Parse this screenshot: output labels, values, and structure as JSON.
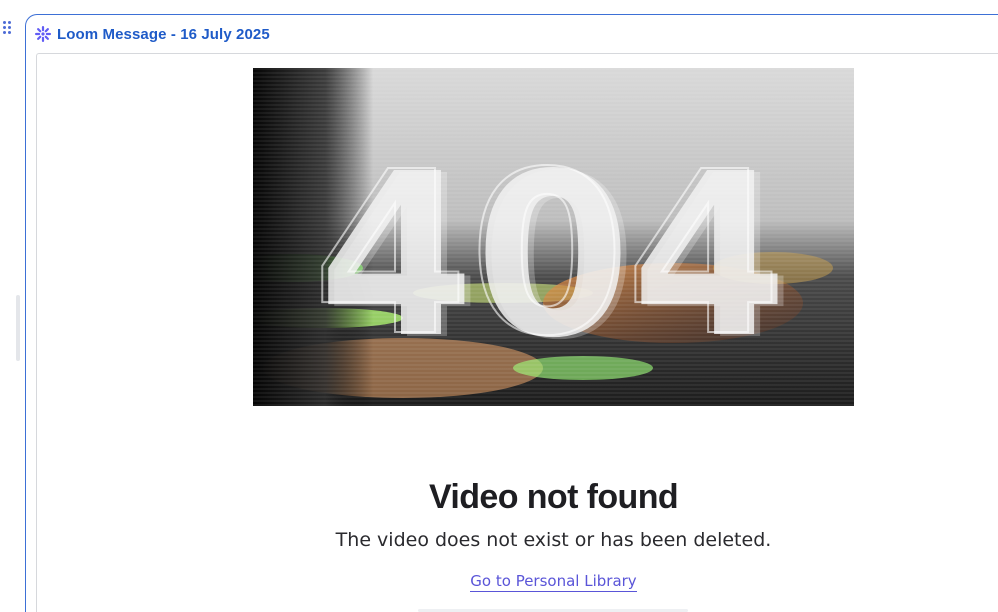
{
  "embed": {
    "title": "Loom Message - 16 July 2025",
    "icon": "loom-icon"
  },
  "video": {
    "error_code": "404",
    "headline": "Video not found",
    "message": "The video does not exist or has been deleted.",
    "link_label": "Go to Personal Library"
  },
  "colors": {
    "accent": "#1f5bc8",
    "frame_border": "#3d70d6",
    "link": "#5a55d8",
    "loom_purple": "#625df5"
  }
}
